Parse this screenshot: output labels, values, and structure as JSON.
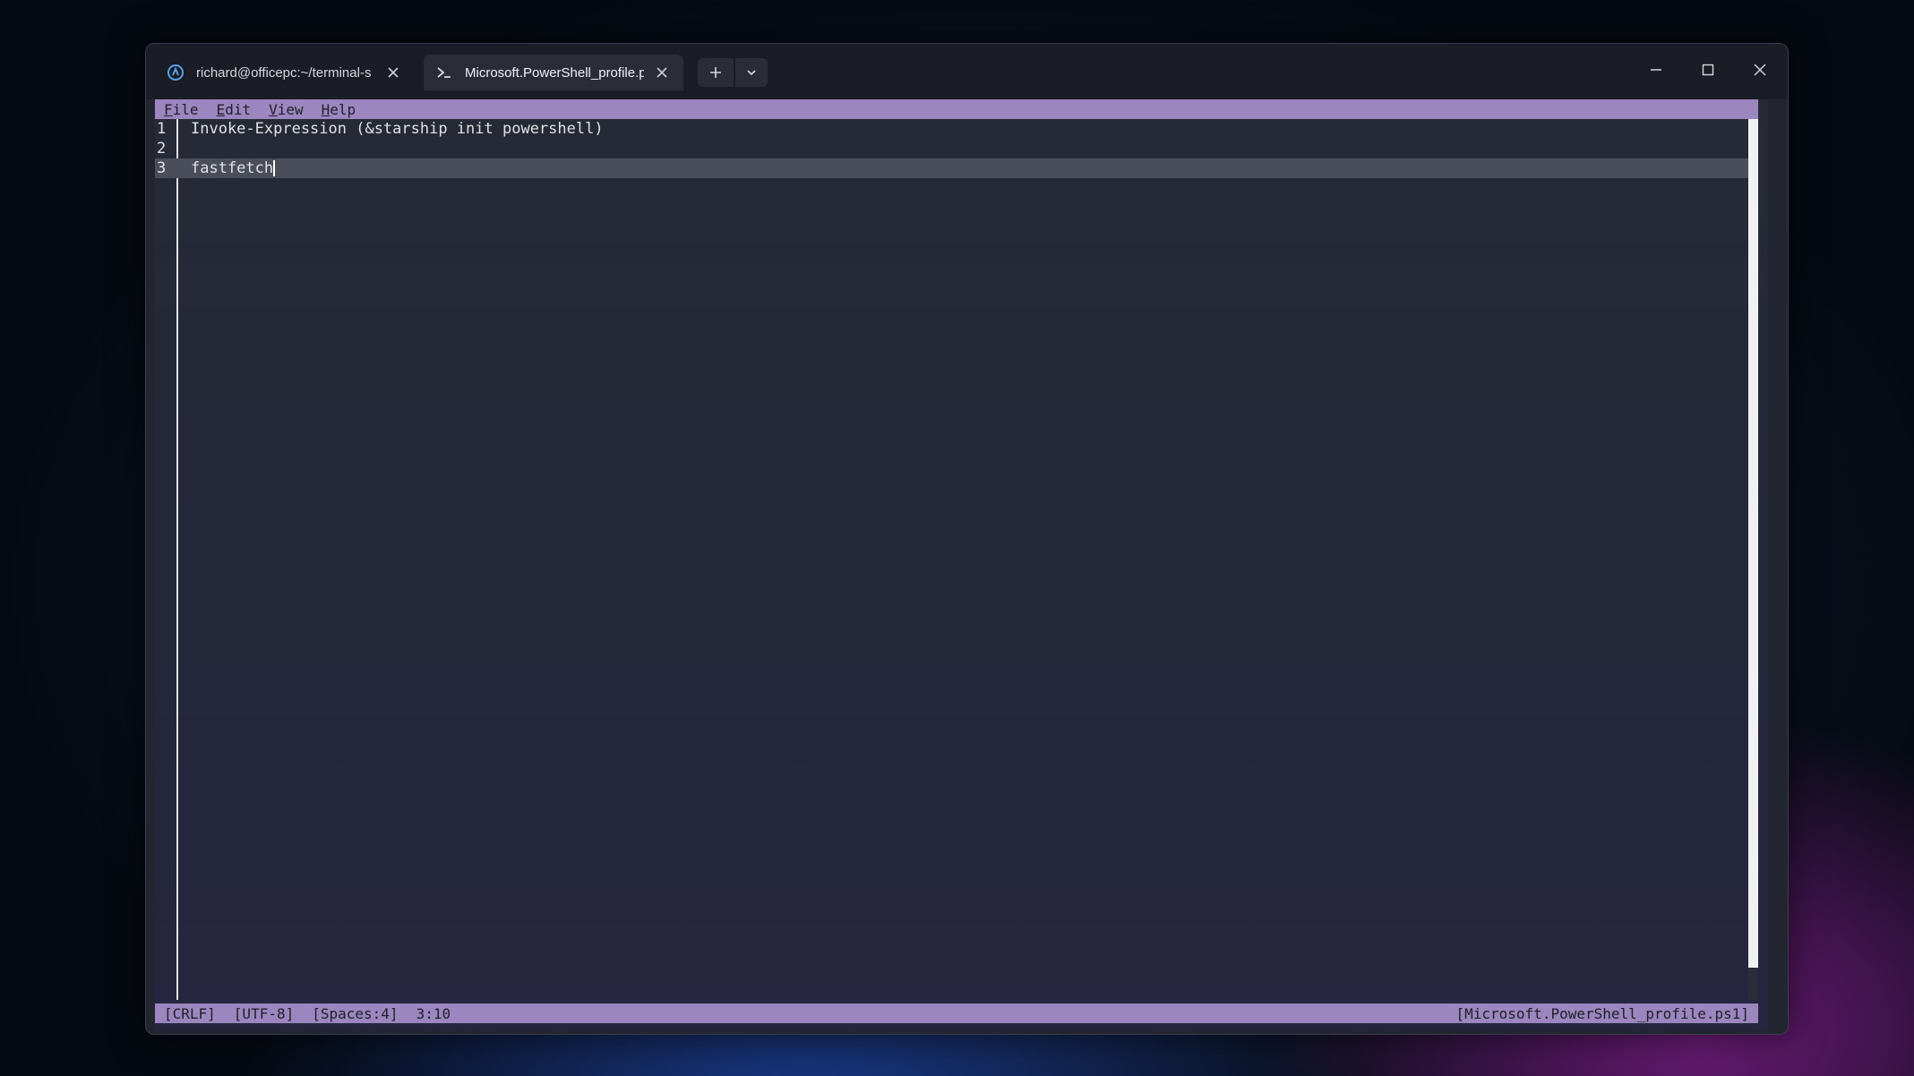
{
  "tabs": [
    {
      "title": "richard@officepc:~/terminal-s",
      "icon": "linux-distro-icon",
      "active": false
    },
    {
      "title": "Microsoft.PowerShell_profile.p",
      "icon": "powershell-prompt-icon",
      "active": true
    }
  ],
  "menu": {
    "items": [
      {
        "mnemonic": "F",
        "rest": "ile"
      },
      {
        "mnemonic": "E",
        "rest": "dit"
      },
      {
        "mnemonic": "V",
        "rest": "iew"
      },
      {
        "mnemonic": "H",
        "rest": "elp"
      }
    ]
  },
  "editor": {
    "lines": [
      {
        "number": "1",
        "text": "Invoke-Expression (&starship init powershell)"
      },
      {
        "number": "2",
        "text": ""
      },
      {
        "number": "3",
        "text": "fastfetch"
      }
    ],
    "current_line": 3
  },
  "status": {
    "line_ending": "[CRLF]",
    "encoding": "[UTF-8]",
    "indent": "[Spaces:4]",
    "position": "3:10",
    "filename": "[Microsoft.PowerShell_profile.ps1]"
  },
  "colors": {
    "accent_bar": "#9b86c0",
    "editor_bg": "#262a36",
    "titlebar_bg": "#1b1d26"
  }
}
